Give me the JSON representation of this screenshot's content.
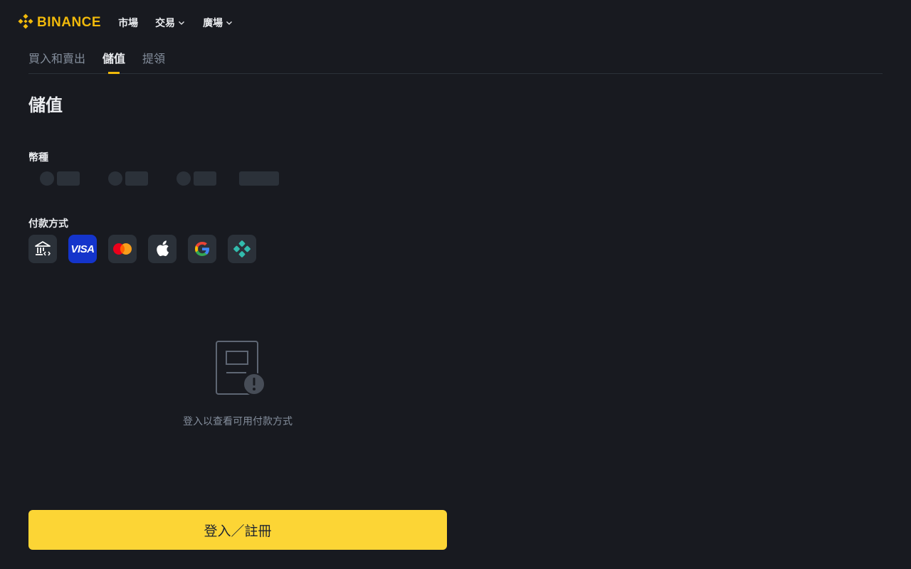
{
  "brand": {
    "name": "BINANCE",
    "accent": "#f0b90b"
  },
  "nav": {
    "items": [
      {
        "label": "市場",
        "has_dropdown": false
      },
      {
        "label": "交易",
        "has_dropdown": true
      },
      {
        "label": "廣場",
        "has_dropdown": true
      }
    ]
  },
  "tabs": [
    {
      "label": "買入和賣出",
      "active": false
    },
    {
      "label": "儲值",
      "active": true
    },
    {
      "label": "提領",
      "active": false
    }
  ],
  "page": {
    "title": "儲值"
  },
  "currency": {
    "label": "幣種"
  },
  "payment": {
    "label": "付款方式",
    "methods": [
      {
        "icon": "bank-transfer-icon"
      },
      {
        "icon": "visa-icon",
        "text": "VISA"
      },
      {
        "icon": "mastercard-icon"
      },
      {
        "icon": "apple-pay-icon"
      },
      {
        "icon": "google-pay-icon"
      },
      {
        "icon": "pix-icon"
      }
    ]
  },
  "empty_state": {
    "message": "登入以查看可用付款方式",
    "icon": "card-warning-icon"
  },
  "cta": {
    "label": "登入／註冊",
    "color": "#fcd535"
  }
}
